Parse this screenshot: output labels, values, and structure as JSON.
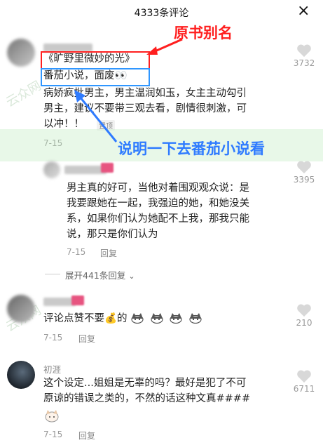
{
  "header": {
    "title": "4333条评论",
    "close": "×"
  },
  "annotations": {
    "red_label": "原书别名",
    "blue_label": "说明一下去番茄小说看"
  },
  "comments": [
    {
      "text_line1": "《旷野里微妙的光》",
      "text_line2": "番茄小说，面废👀",
      "text_line3": "病娇疯批男主，男主温润如玉，女主主动勾引",
      "text_line4": "男主，建议不要带三观去看，剧情很刺激，可",
      "text_line5": "以冲！！",
      "tag": "置顶",
      "date": "7-15",
      "likes": "3732"
    },
    {
      "text_line1": "男主真的好可，当他对着围观观众说：是",
      "text_line2": "我要跟她在一起，我强迫的她，和她没关",
      "text_line3": "系，如果你们认为她配不上我，那我只能",
      "text_line4": "说，那只是你们认为",
      "date": "7-15",
      "reply": "回复",
      "likes": "3395"
    },
    {
      "expand": "展开441条回复"
    },
    {
      "text": "评论点赞不要💰的",
      "date": "7-15",
      "reply": "回复",
      "likes": "210"
    },
    {
      "name": "初涯",
      "text_line1": "这个设定...姐姐是无辜的吗？最好是犯了不可",
      "text_line2": "原谅的错误之类的，不然的话这种文真####",
      "date": "7-15",
      "reply": "回复",
      "likes": "6711"
    }
  ],
  "watermark": "云众网"
}
